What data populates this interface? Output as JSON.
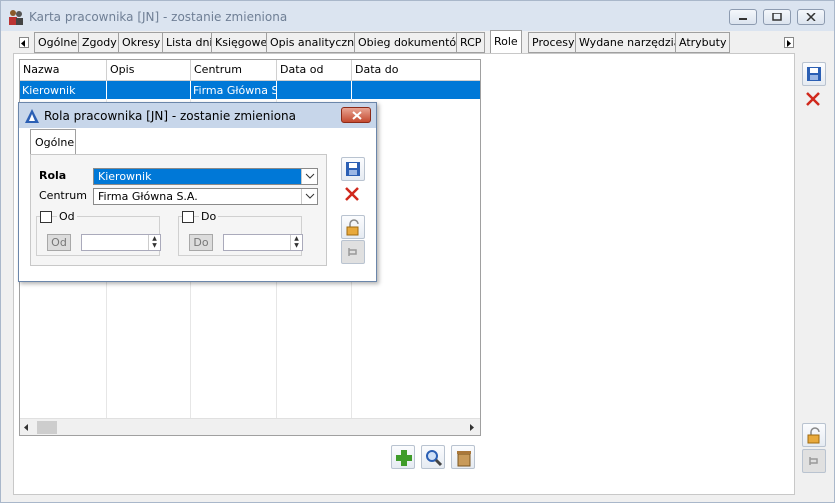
{
  "window": {
    "title": "Karta pracownika [JN] - zostanie zmieniona"
  },
  "tabs": [
    "Ogólne",
    "Zgody",
    "Okresy",
    "Lista dni",
    "Księgowe",
    "Opis analityczny",
    "Obieg dokumentów",
    "RCP",
    "Role",
    "Procesy",
    "Wydane narzędzia",
    "Atrybuty"
  ],
  "active_tab": "Role",
  "grid": {
    "columns": [
      "Nazwa",
      "Opis",
      "Centrum",
      "Data od",
      "Data do"
    ],
    "rows": [
      {
        "nazwa": "Kierownik",
        "opis": "",
        "centrum": "Firma Główna S.A",
        "data_od": "",
        "data_do": ""
      }
    ]
  },
  "dialog": {
    "title": "Rola pracownika [JN] - zostanie zmieniona",
    "tab": "Ogólne",
    "rola_label": "Rola",
    "rola_value": "Kierownik",
    "centrum_label": "Centrum",
    "centrum_value": "Firma Główna S.A.",
    "od_check_label": "Od",
    "od_button": "Od",
    "do_check_label": "Do",
    "do_button": "Do"
  },
  "icons": [
    "save-icon",
    "delete-icon",
    "lock-icon",
    "pin-icon",
    "add-icon",
    "search-icon",
    "trash-icon"
  ],
  "colors": {
    "selection": "#0078d7",
    "save": "#2b5fb4",
    "delete": "#d0281c",
    "add": "#3f9c2a"
  }
}
